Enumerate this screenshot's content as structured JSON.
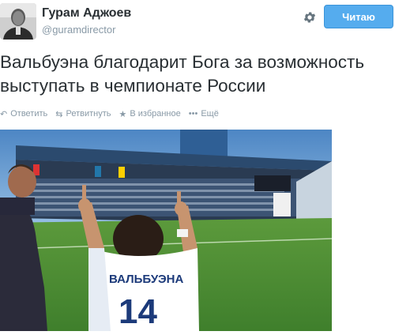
{
  "profile": {
    "name": "Гурам Аджоев",
    "handle": "@guramdirector"
  },
  "follow_button": {
    "label": "Читаю"
  },
  "tweet": {
    "text": "Вальбуэна благодарит Бога за возможность выступать в чемпионате России"
  },
  "actions": [
    {
      "icon": "reply-icon",
      "label": "Ответить"
    },
    {
      "icon": "retweet-icon",
      "label": "Ретвитнуть"
    },
    {
      "icon": "star-icon",
      "label": "В избранное"
    },
    {
      "icon": "more-icon",
      "label": "Ещё"
    }
  ],
  "photo": {
    "jersey_name": "ВАЛЬБУЭНА",
    "jersey_number": "14"
  },
  "colors": {
    "follow_button": "#55acee",
    "text": "#292f33",
    "muted": "#8899a6"
  }
}
